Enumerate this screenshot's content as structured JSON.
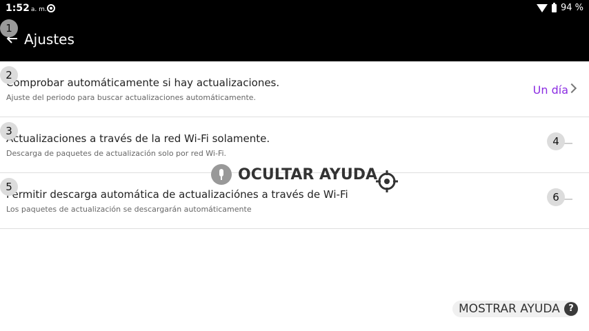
{
  "statusbar": {
    "time": "1:52",
    "ampm": "a. m.",
    "battery": "94 %"
  },
  "appbar": {
    "title": "Ajustes",
    "back_icon": "arrow-back-icon"
  },
  "badges": [
    "1",
    "2",
    "3",
    "4",
    "5",
    "6"
  ],
  "settings": [
    {
      "title": "Comprobar automáticamente si hay actualizaciones.",
      "subtitle": "Ajuste del periodo para buscar actualizaciones automáticamente.",
      "value": "Un día",
      "control": "chevron-right-icon"
    },
    {
      "title": "Actualizaciones a través de la red Wi-Fi solamente.",
      "subtitle": "Descarga de paquetes de actualización solo por red Wi-Fi.",
      "control": "toggle",
      "on": false
    },
    {
      "title": "Permitir descarga automática de actualizaciónes a través de Wi-Fi",
      "subtitle": "Los paquetes de actualización se descargarán automáticamente",
      "control": "toggle",
      "on": false
    }
  ],
  "overlay": {
    "hide_help": "OCULTAR AYUDA",
    "mic_icon": "microphone-icon",
    "target_icon": "crosshair-target-icon"
  },
  "help_button": {
    "label": "MOSTRAR AYUDA",
    "icon_text": "?"
  },
  "colors": {
    "accent": "#8a2be2",
    "appbar": "#000000"
  }
}
